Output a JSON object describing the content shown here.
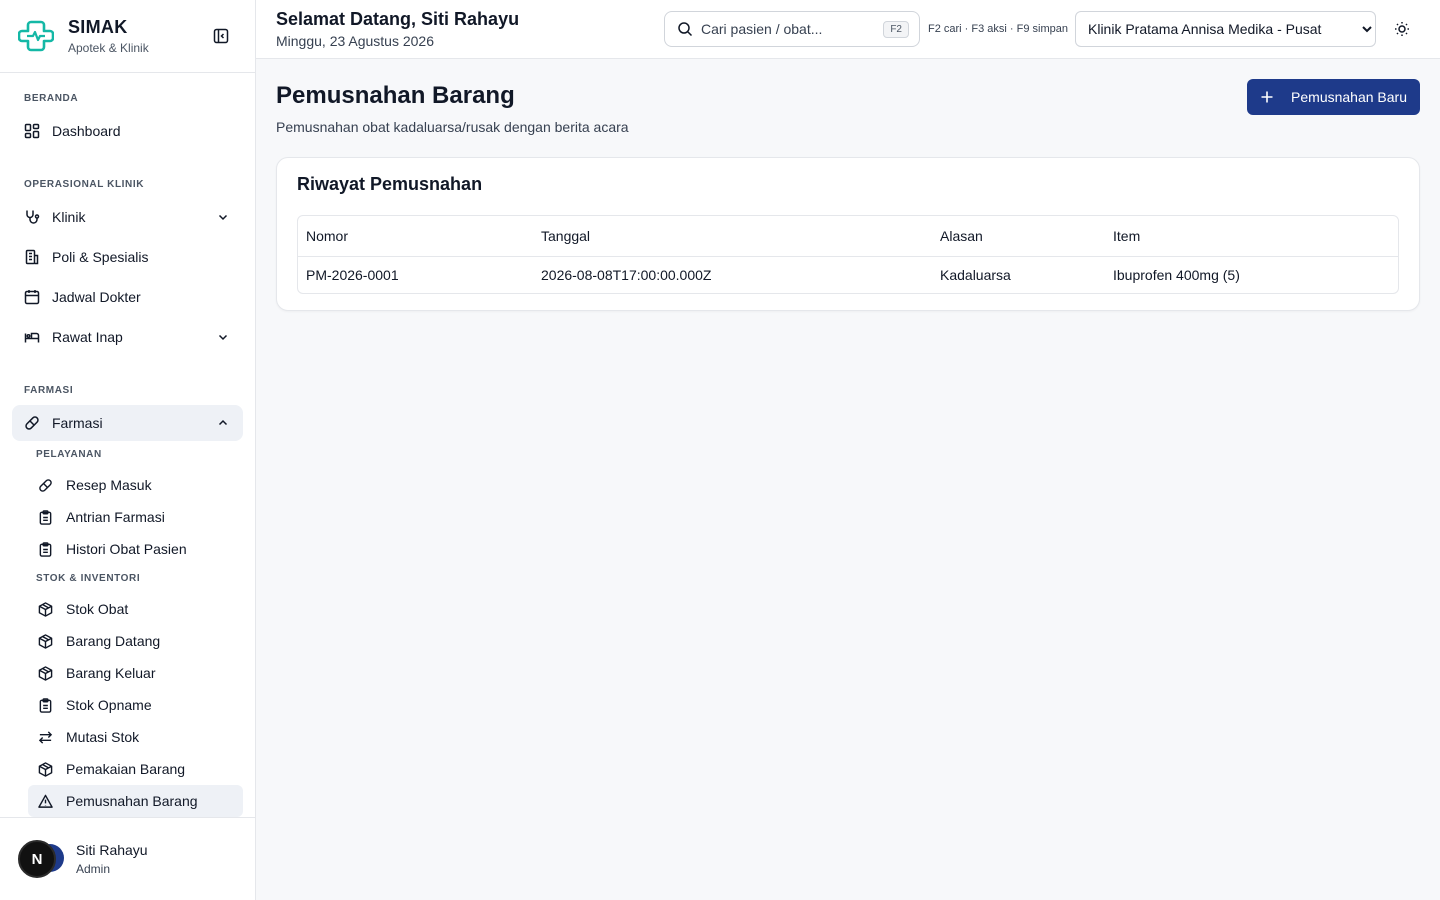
{
  "brand": {
    "name": "SIMAK",
    "subtitle": "Apotek & Klinik"
  },
  "sidebar": {
    "section_home": "BERANDA",
    "dashboard": "Dashboard",
    "section_ops": "OPERASIONAL KLINIK",
    "klinik": "Klinik",
    "poli": "Poli & Spesialis",
    "jadwal": "Jadwal Dokter",
    "rawat_inap": "Rawat Inap",
    "section_farmasi": "FARMASI",
    "farmasi": "Farmasi",
    "sub_pelayanan": "PELAYANAN",
    "resep_masuk": "Resep Masuk",
    "antrian_farmasi": "Antrian Farmasi",
    "histori_obat": "Histori Obat Pasien",
    "sub_stok": "STOK & INVENTORI",
    "stok_obat": "Stok Obat",
    "barang_datang": "Barang Datang",
    "barang_keluar": "Barang Keluar",
    "stok_opname": "Stok Opname",
    "mutasi_stok": "Mutasi Stok",
    "pemakaian_barang": "Pemakaian Barang",
    "pemusnahan_barang": "Pemusnahan Barang"
  },
  "user": {
    "initial": "N",
    "name": "Siti Rahayu",
    "role": "Admin"
  },
  "topbar": {
    "greeting": "Selamat Datang, Siti Rahayu",
    "date": "Minggu, 23 Agustus 2026",
    "search_placeholder": "Cari pasien / obat...",
    "search_key": "F2",
    "hotkeys": "F2 cari · F3 aksi · F9 simpan",
    "clinic": "Klinik Pratama Annisa Medika - Pusat"
  },
  "page": {
    "title": "Pemusnahan Barang",
    "subtitle": "Pemusnahan obat kadaluarsa/rusak dengan berita acara",
    "new_button": "Pemusnahan Baru"
  },
  "history": {
    "title": "Riwayat Pemusnahan",
    "columns": {
      "nomor": "Nomor",
      "tanggal": "Tanggal",
      "alasan": "Alasan",
      "item": "Item"
    },
    "rows": [
      {
        "nomor": "PM-2026-0001",
        "tanggal": "2026-08-08T17:00:00.000Z",
        "alasan": "Kadaluarsa",
        "item": "Ibuprofen 400mg (5)"
      }
    ]
  },
  "colors": {
    "primary": "#1e3a8a",
    "brand_teal": "#14b8a6",
    "active_bg": "#eef1f6"
  }
}
